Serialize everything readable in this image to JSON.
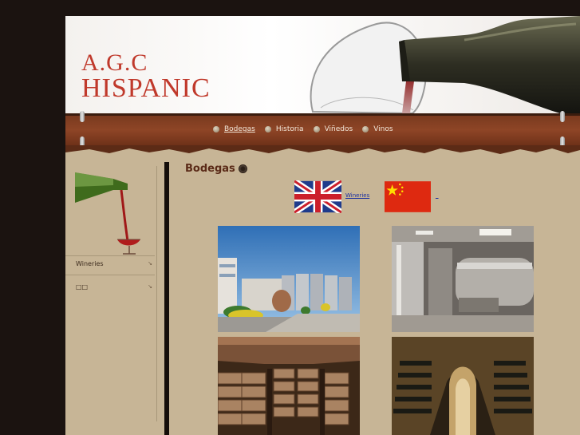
{
  "header": {
    "logo_line1": "A.G.C",
    "logo_line2": "HISPANIC"
  },
  "nav": {
    "items": [
      {
        "label": "Bodegas",
        "active": true
      },
      {
        "label": "Historia",
        "active": false
      },
      {
        "label": "Viñedos",
        "active": false
      },
      {
        "label": "Vinos",
        "active": false
      }
    ]
  },
  "sidebar": {
    "items": [
      {
        "label": "Wineries"
      },
      {
        "label": "□□"
      }
    ]
  },
  "content": {
    "title": "Bodegas",
    "languages": [
      {
        "flag": "uk-flag",
        "label": "Wineries"
      },
      {
        "flag": "china-flag",
        "label": "_"
      }
    ],
    "photos": [
      "winery-exterior-photo",
      "stainless-tanks-photo",
      "barrel-cellar-photo",
      "bottle-tunnel-photo"
    ]
  },
  "colors": {
    "logo": "#c0392b",
    "nav_band": "#8e4526",
    "background": "#c7b596",
    "title": "#5a2a17"
  }
}
